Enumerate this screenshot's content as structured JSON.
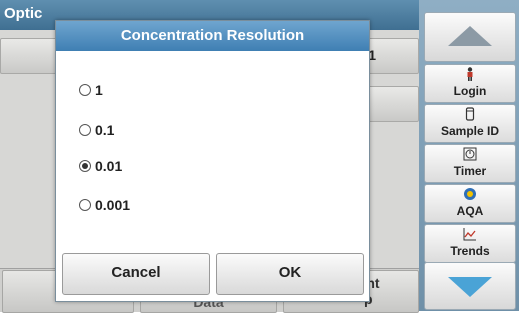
{
  "background": {
    "title_fragment": "Optic",
    "value_fragment": "1",
    "bottom_right_label_line1": "nent",
    "bottom_right_label_line2": "p",
    "bottom_mid_fragment": "Data"
  },
  "dialog": {
    "title": "Concentration Resolution",
    "options": [
      {
        "label": "1",
        "selected": false
      },
      {
        "label": "0.1",
        "selected": false
      },
      {
        "label": "0.01",
        "selected": true
      },
      {
        "label": "0.001",
        "selected": false
      }
    ],
    "cancel_label": "Cancel",
    "ok_label": "OK"
  },
  "sidebar": {
    "scroll_up_icon": "triangle-up",
    "scroll_down_icon": "triangle-down",
    "items": [
      {
        "label": "Login",
        "icon": "person-icon"
      },
      {
        "label": "Sample ID",
        "icon": "vial-icon"
      },
      {
        "label": "Timer",
        "icon": "timer-icon"
      },
      {
        "label": "AQA",
        "icon": "aqa-icon"
      },
      {
        "label": "Trends",
        "icon": "trend-chart-icon"
      }
    ]
  },
  "colors": {
    "title_bar": "#4f8fc2",
    "sidebar": "#7f9fb6",
    "scroll_down_arrow": "#4aa3d6"
  }
}
